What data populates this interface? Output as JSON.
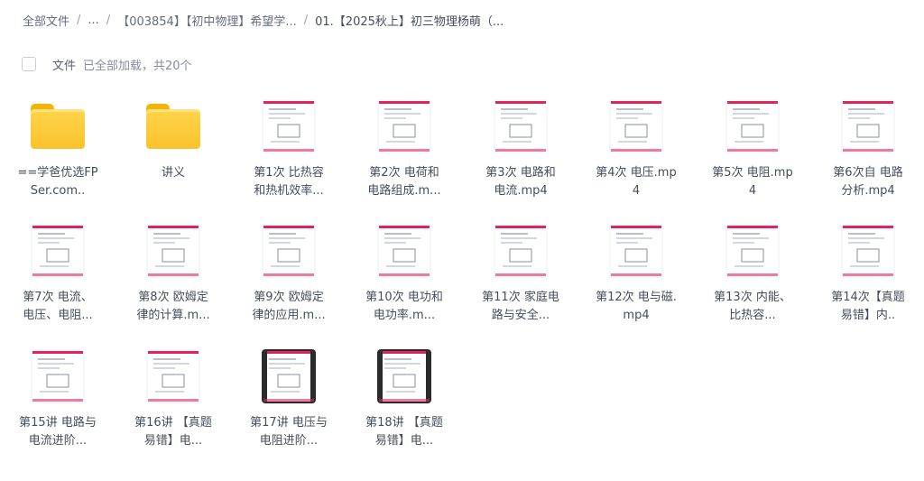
{
  "breadcrumb": {
    "root": "全部文件",
    "ellipsis": "...",
    "parent": "【003854】【初中物理】希望学...",
    "current": "01.【2025秋上】初三物理杨萌（..."
  },
  "toolbar": {
    "file_label": "文件",
    "status": "已全部加载，共20个"
  },
  "colors": {
    "accent": "#e0245e",
    "folder": "#f9c22d",
    "text": "#454d5a"
  },
  "items": [
    {
      "name": "==学爸优选FPSer.com..",
      "icon": "folder-icon",
      "dark": false
    },
    {
      "name": "讲义",
      "icon": "folder-icon",
      "dark": false
    },
    {
      "name": "第1次 比热容和热机效率...",
      "icon": "video-thumbnail",
      "dark": false
    },
    {
      "name": "第2次 电荷和电路组成.m...",
      "icon": "video-thumbnail",
      "dark": false
    },
    {
      "name": "第3次 电路和电流.mp4",
      "icon": "video-thumbnail",
      "dark": false
    },
    {
      "name": "第4次 电压.mp4",
      "icon": "video-thumbnail",
      "dark": false
    },
    {
      "name": "第5次 电阻.mp4",
      "icon": "video-thumbnail",
      "dark": false
    },
    {
      "name": "第6次自 电路分析.mp4",
      "icon": "video-thumbnail",
      "dark": false
    },
    {
      "name": "第7次 电流、电压、电阻...",
      "icon": "video-thumbnail",
      "dark": false
    },
    {
      "name": "第8次 欧姆定律的计算.m...",
      "icon": "video-thumbnail",
      "dark": false
    },
    {
      "name": "第9次 欧姆定律的应用.m...",
      "icon": "video-thumbnail",
      "dark": false
    },
    {
      "name": "第10次 电功和电功率.m...",
      "icon": "video-thumbnail",
      "dark": false
    },
    {
      "name": "第11次 家庭电路与安全...",
      "icon": "video-thumbnail",
      "dark": false
    },
    {
      "name": "第12次 电与磁.mp4",
      "icon": "video-thumbnail",
      "dark": false
    },
    {
      "name": "第13次 内能、比热容...",
      "icon": "video-thumbnail",
      "dark": false
    },
    {
      "name": "第14次【真题易错】内..",
      "icon": "video-thumbnail",
      "dark": false
    },
    {
      "name": "第15讲 电路与电流进阶...",
      "icon": "video-thumbnail",
      "dark": false
    },
    {
      "name": "第16讲 【真题易错】电...",
      "icon": "video-thumbnail",
      "dark": false
    },
    {
      "name": "第17讲 电压与电阻进阶...",
      "icon": "video-thumbnail",
      "dark": true
    },
    {
      "name": "第18讲 【真题易错】电...",
      "icon": "video-thumbnail",
      "dark": true
    }
  ]
}
